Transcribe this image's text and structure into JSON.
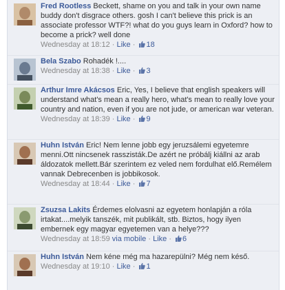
{
  "comments": [
    {
      "author": "Fred Rootless",
      "text": "Beckett, shame on you and talk in your own name buddy don't disgrace others. gosh I can't believe this prick is an associate professor WTF?! what do you guys learn in Oxford? how to become a prick? well done",
      "time": "Wednesday at 18:12",
      "via": "",
      "like": "Like",
      "likes": "18",
      "avatar_icon": "profile-photo-icon",
      "avatar_color": "#b08a6a"
    },
    {
      "author": "Bela Szabo",
      "text": "Rohadék !....",
      "time": "Wednesday at 18:38",
      "via": "",
      "like": "Like",
      "likes": "3",
      "avatar_icon": "profile-photo-icon",
      "avatar_color": "#6a7a90"
    },
    {
      "author": "Arthur Imre Akácsos",
      "text": "Eric, Yes, I believe that english speakers will understand what's mean a really hero, what's mean to really love your country and nation, even if you are not jude, or american war veteran.",
      "time": "Wednesday at 18:39",
      "via": "",
      "like": "Like",
      "likes": "9",
      "avatar_icon": "profile-photo-icon",
      "avatar_color": "#7a8a5a"
    },
    {
      "author": "Huhn István",
      "text": "Eric! Nem lenne jobb egy jeruzsálemi egyetemre menni.Ott nincsenek rasszisták.De azért ne próbálj kiállni az arab áldozatok mellett.Bár szerintem ez veled nem fordulhat elő.Remélem vannak Debrecenben is jobbikosok.",
      "time": "Wednesday at 18:44",
      "via": "",
      "like": "Like",
      "likes": "7",
      "avatar_icon": "profile-photo-icon",
      "avatar_color": "#a07050"
    },
    {
      "author": "Zsuzsa Lakits",
      "text": "Érdemes elolvasni az egyetem honlapján a róla irtakat....melyik tanszék, mit publikált, stb. Biztos, hogy ilyen embernek egy magyar egyetemen van a helye???",
      "time": "Wednesday at 18:59",
      "via": "via mobile",
      "like": "Like",
      "likes": "6",
      "avatar_icon": "profile-photo-icon",
      "avatar_color": "#8a9a70"
    },
    {
      "author": "Huhn István",
      "text": "Nem kéne még ma hazarepülni? Még nem késő.",
      "time": "Wednesday at 19:10",
      "via": "",
      "like": "Like",
      "likes": "1",
      "avatar_icon": "profile-photo-icon",
      "avatar_color": "#a07050"
    }
  ],
  "separator": " · ",
  "thumb_icon": "thumbs-up-icon"
}
